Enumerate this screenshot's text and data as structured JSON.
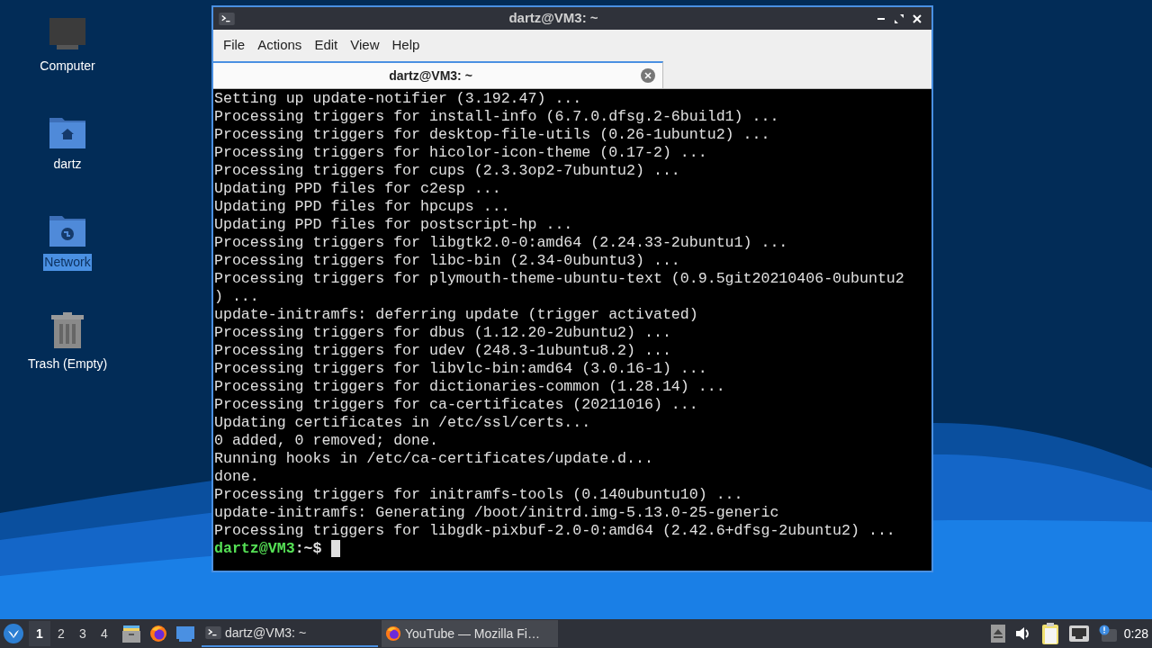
{
  "desktop_icons": [
    {
      "kind": "computer",
      "label": "Computer",
      "selected": false
    },
    {
      "kind": "home",
      "label": "dartz",
      "selected": false
    },
    {
      "kind": "network",
      "label": "Network",
      "selected": true
    },
    {
      "kind": "trash",
      "label": "Trash (Empty)",
      "selected": false
    }
  ],
  "window": {
    "title": "dartz@VM3: ~",
    "menu": [
      "File",
      "Actions",
      "Edit",
      "View",
      "Help"
    ],
    "tabs": [
      {
        "label": "dartz@VM3: ~",
        "selected": true
      }
    ],
    "lines": [
      "Setting up update-notifier (3.192.47) ...",
      "Processing triggers for install-info (6.7.0.dfsg.2-6build1) ...",
      "Processing triggers for desktop-file-utils (0.26-1ubuntu2) ...",
      "Processing triggers for hicolor-icon-theme (0.17-2) ...",
      "Processing triggers for cups (2.3.3op2-7ubuntu2) ...",
      "Updating PPD files for c2esp ...",
      "Updating PPD files for hpcups ...",
      "Updating PPD files for postscript-hp ...",
      "Processing triggers for libgtk2.0-0:amd64 (2.24.33-2ubuntu1) ...",
      "Processing triggers for libc-bin (2.34-0ubuntu3) ...",
      "Processing triggers for plymouth-theme-ubuntu-text (0.9.5git20210406-0ubuntu2",
      ") ...",
      "update-initramfs: deferring update (trigger activated)",
      "Processing triggers for dbus (1.12.20-2ubuntu2) ...",
      "Processing triggers for udev (248.3-1ubuntu8.2) ...",
      "Processing triggers for libvlc-bin:amd64 (3.0.16-1) ...",
      "Processing triggers for dictionaries-common (1.28.14) ...",
      "Processing triggers for ca-certificates (20211016) ...",
      "Updating certificates in /etc/ssl/certs...",
      "0 added, 0 removed; done.",
      "Running hooks in /etc/ca-certificates/update.d...",
      "done.",
      "Processing triggers for initramfs-tools (0.140ubuntu10) ...",
      "update-initramfs: Generating /boot/initrd.img-5.13.0-25-generic",
      "Processing triggers for libgdk-pixbuf-2.0-0:amd64 (2.42.6+dfsg-2ubuntu2) ..."
    ],
    "prompt": {
      "user": "dartz@VM3",
      "rest": ":~$"
    }
  },
  "taskbar": {
    "workspaces": [
      {
        "label": "1",
        "selected": true
      },
      {
        "label": "2",
        "selected": false
      },
      {
        "label": "3",
        "selected": false
      },
      {
        "label": "4",
        "selected": false
      }
    ],
    "launchers": [
      {
        "kind": "files"
      },
      {
        "kind": "browser"
      },
      {
        "kind": "desktop"
      }
    ],
    "tasks": [
      {
        "kind": "terminal",
        "label": "dartz@VM3: ~",
        "selected": true
      },
      {
        "kind": "browser",
        "label": "YouTube — Mozilla Fi…",
        "selected": false
      }
    ],
    "tray": [
      {
        "kind": "eject"
      },
      {
        "kind": "volume"
      },
      {
        "kind": "clipboard"
      },
      {
        "kind": "network"
      },
      {
        "kind": "notification"
      }
    ],
    "clock": "0:28"
  }
}
